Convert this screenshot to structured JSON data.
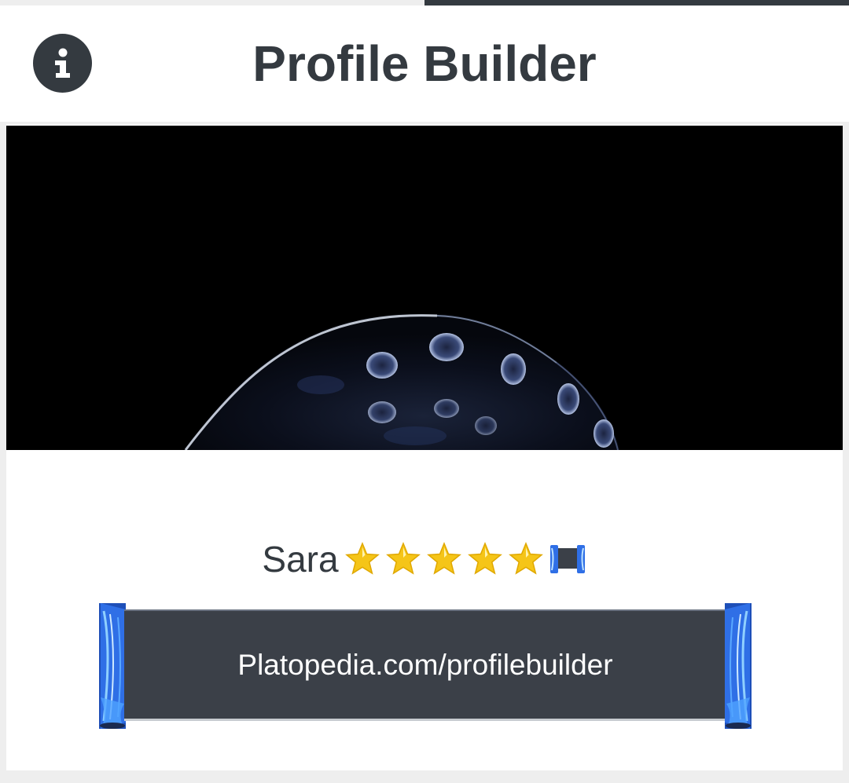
{
  "progress": {
    "fraction": 0.5
  },
  "header": {
    "title": "Profile Builder",
    "info_icon": "info-icon"
  },
  "banner": {
    "image_icon": "space-rock-image"
  },
  "profile": {
    "name": "Sara",
    "star_count": 5,
    "star_icon": "star-icon",
    "badge_icon": "scroll-icon"
  },
  "scroll": {
    "link_text": "Platopedia.com/profilebuilder"
  },
  "colors": {
    "dark": "#343a40",
    "scroll_body": "#3b4048",
    "flame_blue": "#2f6fe6",
    "star_gold": "#f5c518"
  }
}
